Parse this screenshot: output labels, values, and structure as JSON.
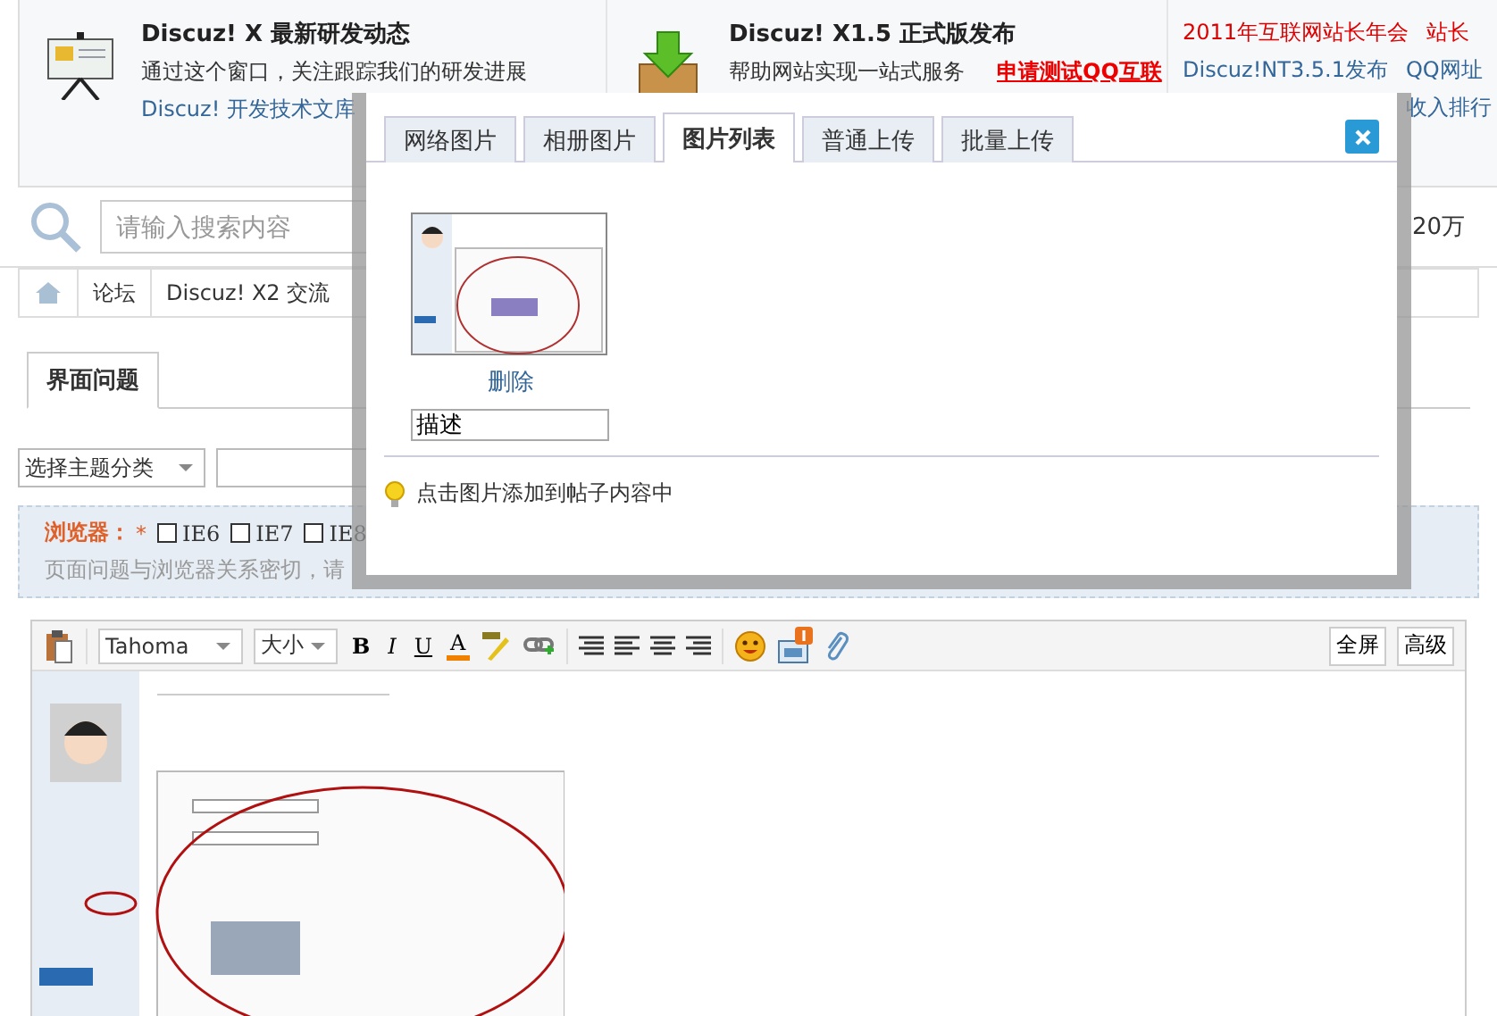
{
  "banner": [
    {
      "title": "Discuz! X 最新研发动态",
      "text": "通过这个窗口，关注跟踪我们的研发进展",
      "link": "Discuz! 开发技术文库"
    },
    {
      "title": "Discuz! X1.5 正式版发布",
      "text": "帮助网站实现一站式服务",
      "promo": "申请测试QQ互联"
    }
  ],
  "news": [
    [
      {
        "text": "2011年互联网站长年会",
        "kind": "hot"
      },
      {
        "text": "站长",
        "kind": "hot"
      }
    ],
    [
      {
        "text": "Discuz!NT3.5.1发布",
        "kind": "normal"
      },
      {
        "text": "QQ网址",
        "kind": "normal"
      }
    ],
    [
      {
        "text": "收入排行",
        "kind": "normal"
      }
    ]
  ],
  "search": {
    "placeholder": "请输入搜索内容",
    "side_text": "20万"
  },
  "breadcrumb": [
    "论坛",
    "Discuz! X2 交流"
  ],
  "thread_tab": "界面问题",
  "category_select": "选择主题分类",
  "browser_notice": {
    "label": "浏览器：",
    "required": "*",
    "options": [
      {
        "label": "IE6",
        "checked": false
      },
      {
        "label": "IE7",
        "checked": false
      },
      {
        "label": "IE8",
        "checked": false
      }
    ],
    "hint": "页面问题与浏览器关系密切，请"
  },
  "toolbar": {
    "font": "Tahoma",
    "size": "大小",
    "format": [
      "B",
      "I",
      "U",
      "A"
    ],
    "right_buttons": [
      "全屏",
      "高级"
    ]
  },
  "dialog": {
    "tabs": [
      {
        "label": "网络图片",
        "selected": false
      },
      {
        "label": "相册图片",
        "selected": false
      },
      {
        "label": "图片列表",
        "selected": true
      },
      {
        "label": "普通上传",
        "selected": false
      },
      {
        "label": "批量上传",
        "selected": false
      }
    ],
    "delete": "删除",
    "description": "描述",
    "tip": "点击图片添加到帖子内容中"
  }
}
